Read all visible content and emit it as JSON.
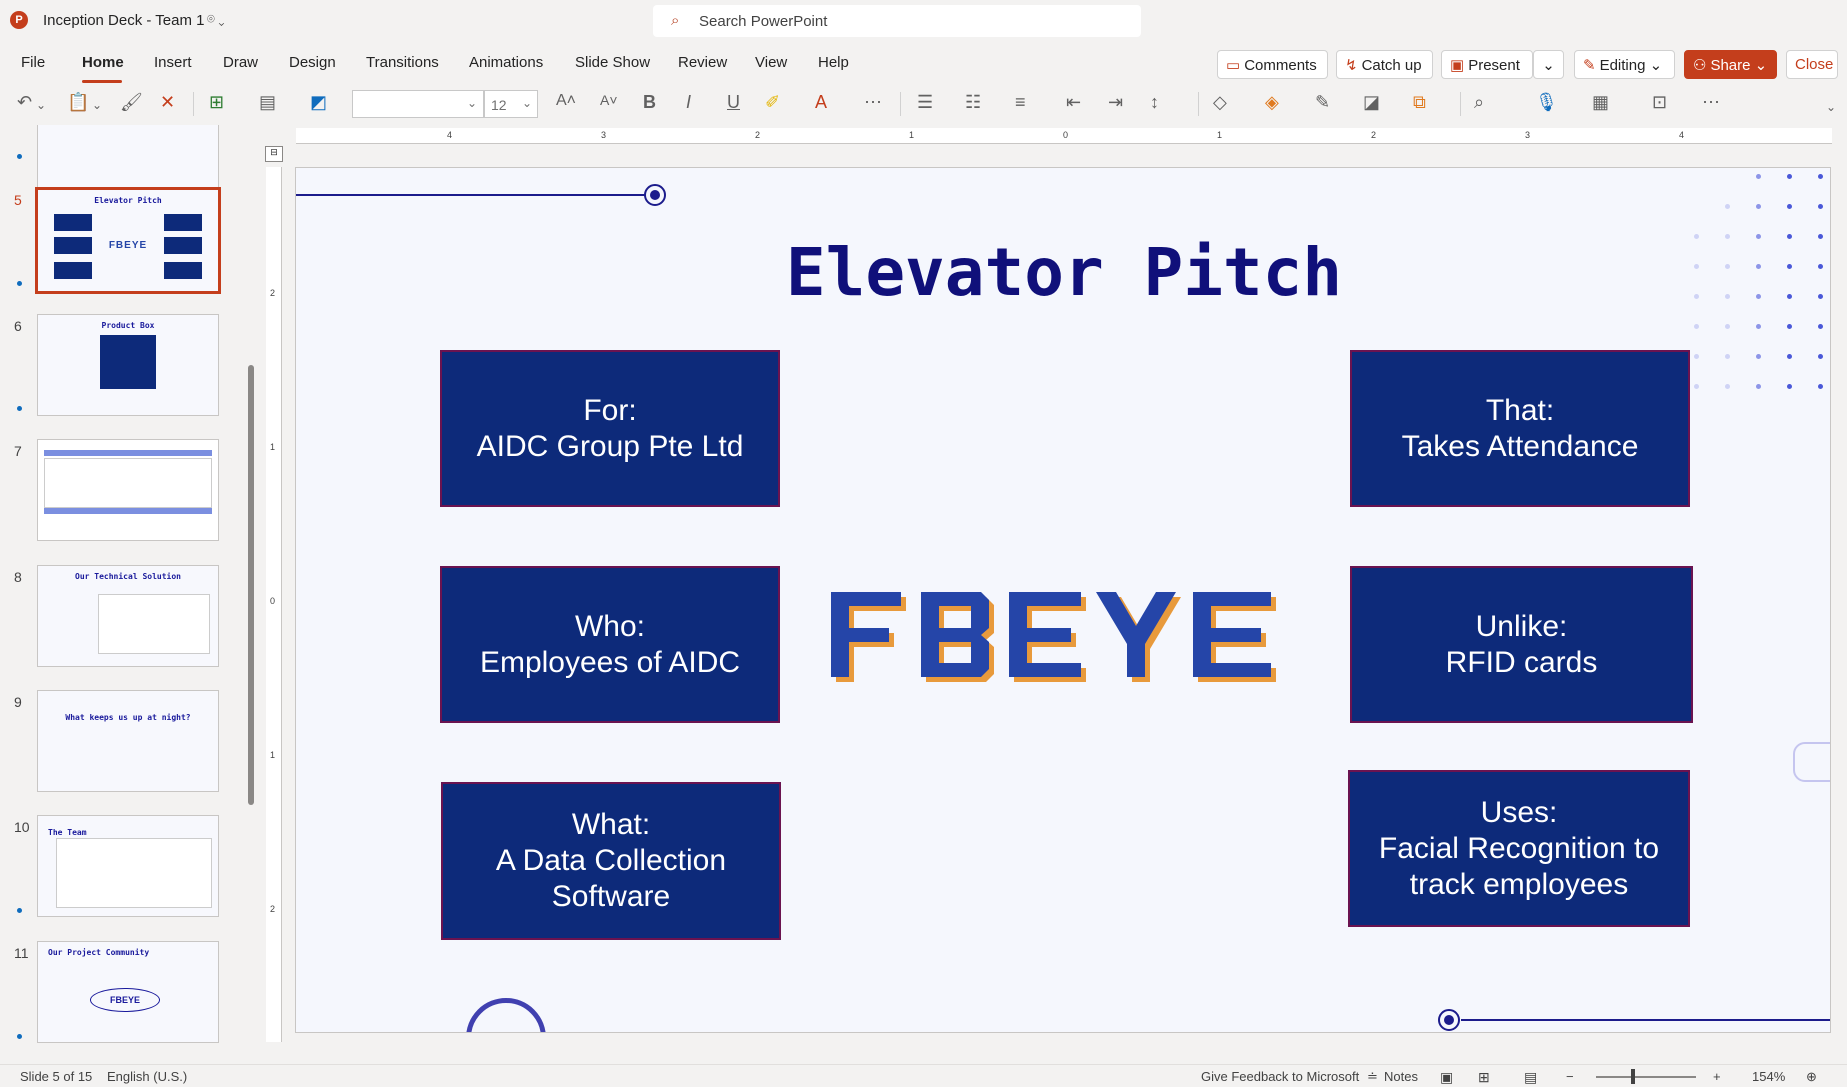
{
  "titlebar": {
    "app_icon": "powerpoint-logo-icon",
    "app_icon_letter": "P",
    "doc_title": "Inception Deck - Team 1",
    "title_icons": "⌾ ⌄",
    "search_icon": "search-icon",
    "search_placeholder": "Search PowerPoint"
  },
  "menu": {
    "tabs": [
      "File",
      "Home",
      "Insert",
      "Draw",
      "Design",
      "Transitions",
      "Animations",
      "Slide Show",
      "Review",
      "View",
      "Help"
    ],
    "active_tab": "Home",
    "comments": "Comments",
    "catch_up": "Catch up",
    "present": "Present",
    "editing": "Editing",
    "share": "Share",
    "close": "Close"
  },
  "toolbar": {
    "font_size": "12",
    "icons": [
      "undo-icon",
      "paste-icon",
      "format-painter-icon",
      "clear-icon",
      "new-slide-icon",
      "layout-icon",
      "shape-fill-icon",
      "increase-font-icon",
      "decrease-font-icon",
      "bold-icon",
      "italic-icon",
      "underline-icon",
      "highlight-icon",
      "font-color-icon",
      "more-icon",
      "bullets-icon",
      "numbering-icon",
      "align-icon",
      "decrease-indent-icon",
      "increase-indent-icon",
      "line-spacing-icon",
      "shapes-icon",
      "fill-icon",
      "outline-icon",
      "effects-icon",
      "arrange-icon",
      "find-icon",
      "dictate-icon",
      "designer-icon",
      "add-in-icon",
      "more-options-icon"
    ]
  },
  "thumbnails": [
    {
      "num": "5",
      "title": "Elevator Pitch",
      "active": true
    },
    {
      "num": "6",
      "title": "Product Box",
      "active": false
    },
    {
      "num": "7",
      "title": "",
      "active": false
    },
    {
      "num": "8",
      "title": "Our Technical Solution",
      "active": false
    },
    {
      "num": "9",
      "title": "What keeps us up at night?",
      "active": false
    },
    {
      "num": "10",
      "title": "The Team",
      "active": false
    },
    {
      "num": "11",
      "title": "Our Project Community",
      "active": false
    }
  ],
  "slide": {
    "title": "Elevator Pitch",
    "boxes": {
      "for": [
        "For:",
        "AIDC Group Pte Ltd"
      ],
      "who": [
        "Who:",
        "Employees of AIDC"
      ],
      "what": [
        "What:",
        "A Data Collection",
        "Software"
      ],
      "that": [
        "That:",
        "Takes Attendance"
      ],
      "unlike": [
        "Unlike:",
        "RFID cards"
      ],
      "uses": [
        "Uses:",
        "Facial Recognition to",
        "track employees"
      ]
    },
    "logo_text": "FBEYE",
    "colors": {
      "box": "#0d2a7a",
      "title": "#10107a",
      "accent": "#c43e1c"
    }
  },
  "rulers": {
    "h": [
      "4",
      "3",
      "2",
      "1",
      "0",
      "1",
      "2",
      "3",
      "4"
    ],
    "v": [
      "2",
      "1",
      "0",
      "1",
      "2"
    ]
  },
  "status": {
    "slide_info": "Slide 5 of 15",
    "language": "English (U.S.)",
    "feedback": "Give Feedback to Microsoft",
    "notes": "Notes",
    "zoom": "154%"
  }
}
